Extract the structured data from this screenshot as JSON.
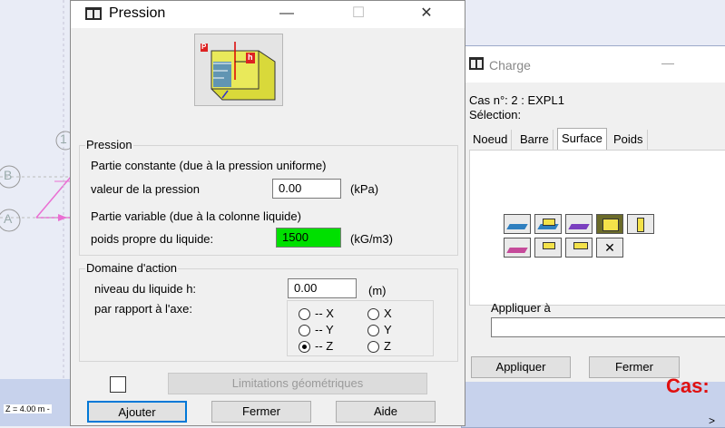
{
  "background": {
    "coord_label": "Z = 4.00 m -",
    "axis_markers": [
      "1",
      "B",
      "A"
    ]
  },
  "charge_dialog": {
    "title": "Charge",
    "minimize_glyph": "—",
    "cas_label": "Cas n°: 2 : EXPL1",
    "selection_label": "Sélection:",
    "tabs": [
      {
        "label": "Noeud",
        "active": false
      },
      {
        "label": "Barre",
        "active": false
      },
      {
        "label": "Surface",
        "active": true
      },
      {
        "label": "Poids et r",
        "active": false
      }
    ],
    "appliquer_a_label": "Appliquer à",
    "appliquer_a_value": "",
    "buttons": {
      "appliquer": "Appliquer",
      "fermer": "Fermer"
    },
    "cas_banner": "Cas:",
    "scroll_glyph": ">",
    "close_load_glyph": "✕"
  },
  "pression_dialog": {
    "title": "Pression",
    "window_controls": {
      "minimize": "—",
      "maximize": "☐",
      "close": "✕"
    },
    "illustration_labels": {
      "p": "P",
      "h": "h"
    },
    "pression_group": {
      "title": "Pression",
      "constant_label": "Partie constante (due à la pression uniforme)",
      "pressure_label": "valeur de la pression",
      "pressure_value": "0.00",
      "pressure_unit": "(kPa)",
      "variable_label": "Partie variable (due à la colonne liquide)",
      "weight_label": "poids propre du liquide:",
      "weight_value": "1500",
      "weight_unit": "(kG/m3)"
    },
    "domaine_group": {
      "title": "Domaine d'action",
      "level_label": "niveau du liquide h:",
      "level_value": "0.00",
      "level_unit": "(m)",
      "axis_label": "par rapport à l'axe:",
      "axis_options": [
        {
          "label": "-- X",
          "selected": false
        },
        {
          "label": "X",
          "selected": false
        },
        {
          "label": "-- Y",
          "selected": false
        },
        {
          "label": "Y",
          "selected": false
        },
        {
          "label": "-- Z",
          "selected": true
        },
        {
          "label": "Z",
          "selected": false
        }
      ]
    },
    "limitations_button": "Limitations géométriques",
    "buttons": {
      "ajouter": "Ajouter",
      "fermer": "Fermer",
      "aide": "Aide"
    }
  }
}
